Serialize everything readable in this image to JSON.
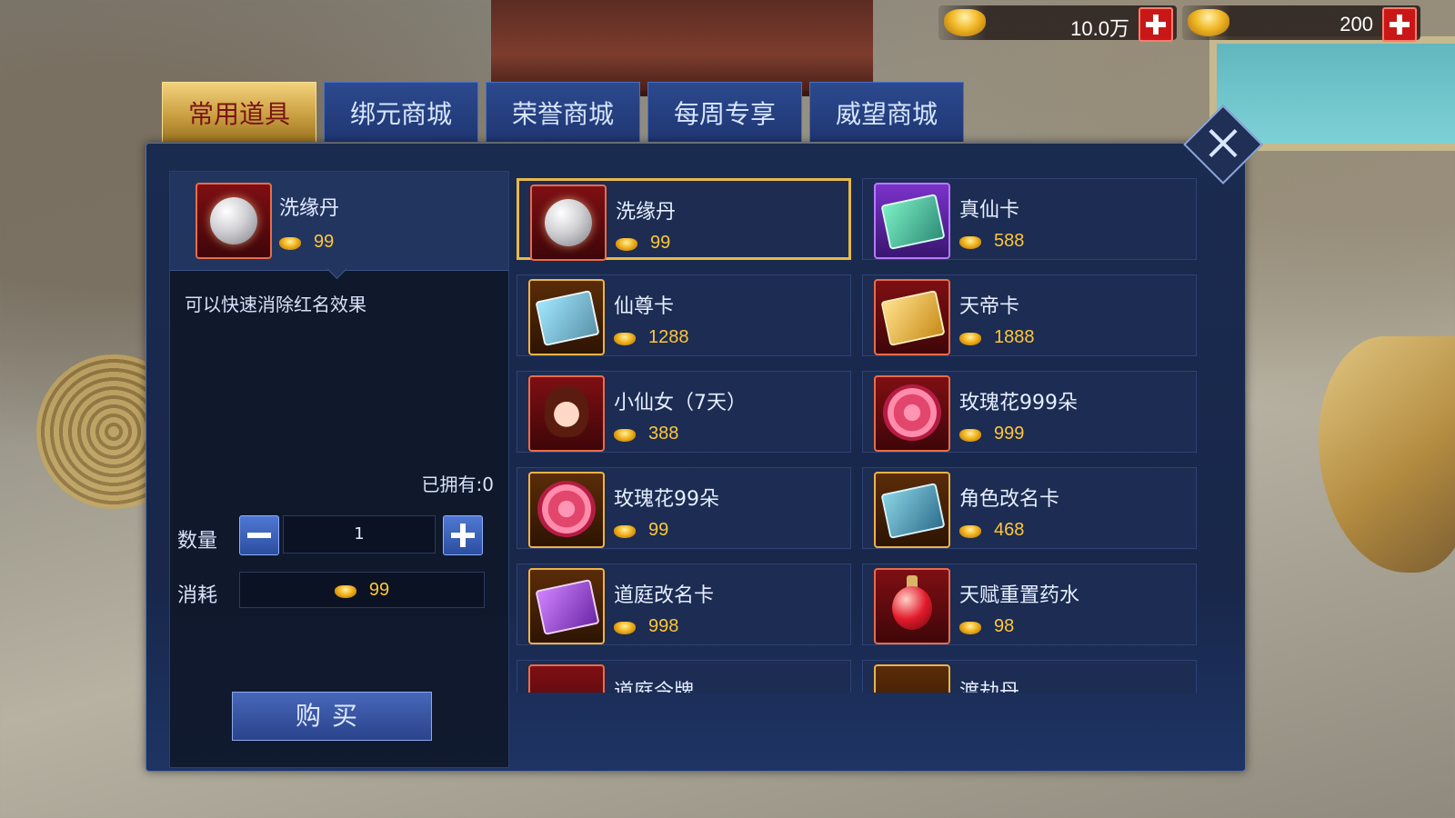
{
  "currency": [
    {
      "icon": "gold-ingot-icon",
      "amount": "10.0万"
    },
    {
      "icon": "bound-ingot-icon",
      "amount": "200"
    }
  ],
  "tabs": [
    {
      "label": "常用道具",
      "active": true
    },
    {
      "label": "绑元商城",
      "active": false
    },
    {
      "label": "荣誉商城",
      "active": false
    },
    {
      "label": "每周专享",
      "active": false
    },
    {
      "label": "威望商城",
      "active": false
    }
  ],
  "selected_item": {
    "name": "洗缘丹",
    "price": "99",
    "description": "可以快速消除红名效果",
    "owned": "已拥有:0"
  },
  "purchase": {
    "quantity_label": "数量",
    "quantity": "1",
    "cost_label": "消耗",
    "cost": "99",
    "buy_label": "购买"
  },
  "items": [
    {
      "name": "洗缘丹",
      "price": "99",
      "icon": "pearl-icon"
    },
    {
      "name": "真仙卡",
      "price": "588",
      "icon": "true-immortal-card-icon"
    },
    {
      "name": "仙尊卡",
      "price": "1288",
      "icon": "immortal-lord-card-icon"
    },
    {
      "name": "天帝卡",
      "price": "1888",
      "icon": "emperor-card-icon"
    },
    {
      "name": "小仙女（7天）",
      "price": "388",
      "icon": "fairy-pet-icon"
    },
    {
      "name": "玫瑰花999朵",
      "price": "999",
      "icon": "rose-basket-icon"
    },
    {
      "name": "玫瑰花99朵",
      "price": "99",
      "icon": "rose-bouquet-icon"
    },
    {
      "name": "角色改名卡",
      "price": "468",
      "icon": "rename-card-icon"
    },
    {
      "name": "道庭改名卡",
      "price": "998",
      "icon": "guild-rename-card-icon"
    },
    {
      "name": "天赋重置药水",
      "price": "98",
      "icon": "potion-icon"
    },
    {
      "name": "道庭令牌",
      "price": "",
      "icon": "token-icon"
    },
    {
      "name": "渡劫丹",
      "price": "",
      "icon": "pill-icon"
    }
  ]
}
